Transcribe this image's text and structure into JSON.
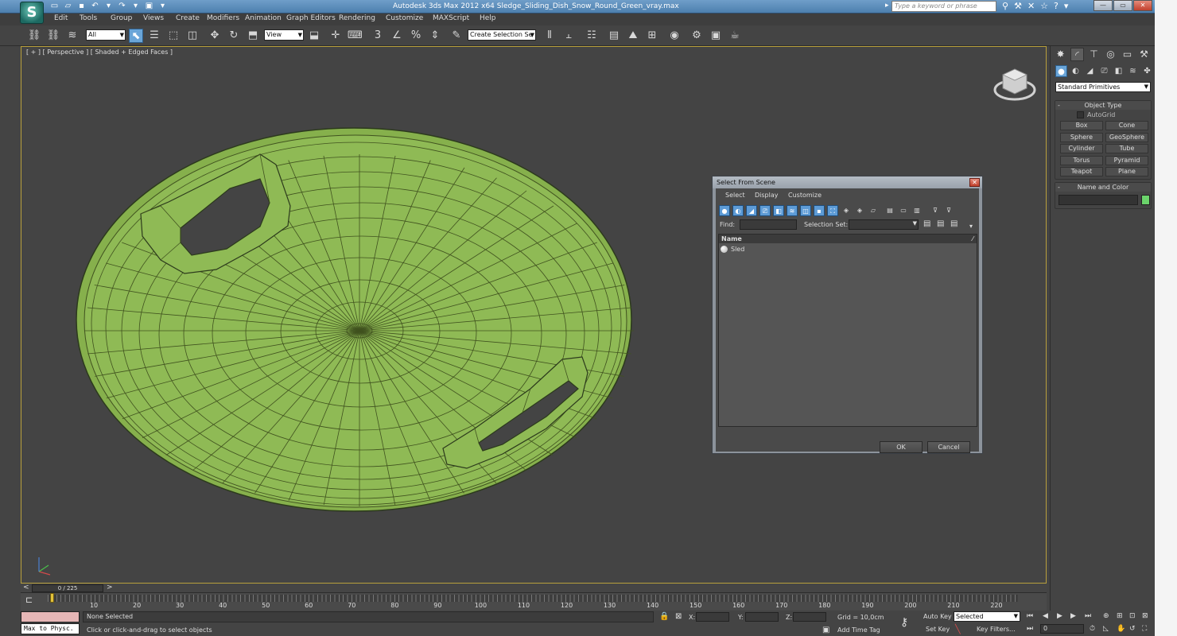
{
  "window": {
    "title": "Autodesk 3ds Max  2012 x64      Sledge_Sliding_Dish_Snow_Round_Green_vray.max",
    "search_placeholder": "Type a keyword or phrase",
    "logo_glyph": "S"
  },
  "menu": [
    "Edit",
    "Tools",
    "Group",
    "Views",
    "Create",
    "Modifiers",
    "Animation",
    "Graph Editors",
    "Rendering",
    "Customize",
    "MAXScript",
    "Help"
  ],
  "toolbar": {
    "filter_value": "All",
    "ref_coord_value": "View",
    "selection_set_value": "Create Selection Se"
  },
  "viewport": {
    "label": "[ + ] [ Perspective ] [ Shaded + Edged Faces ]",
    "object_color": "#8cb552"
  },
  "command_panel": {
    "category_value": "Standard Primitives",
    "object_type_title": "Object Type",
    "autogrid_label": "AutoGrid",
    "primitives": [
      "Box",
      "Cone",
      "Sphere",
      "GeoSphere",
      "Cylinder",
      "Tube",
      "Torus",
      "Pyramid",
      "Teapot",
      "Plane"
    ],
    "name_color_title": "Name and Color",
    "swatch_color": "#6bd36b"
  },
  "dialog": {
    "title": "Select From Scene",
    "menu": [
      "Select",
      "Display",
      "Customize"
    ],
    "find_label": "Find:",
    "selection_set_label": "Selection Set:",
    "list_header": "Name",
    "items": [
      "Sled"
    ],
    "ok_label": "OK",
    "cancel_label": "Cancel"
  },
  "timeline": {
    "slider_label": "0 / 225",
    "ticks": [
      10,
      20,
      30,
      40,
      50,
      60,
      70,
      80,
      90,
      100,
      110,
      120,
      130,
      140,
      150,
      160,
      170,
      180,
      190,
      200,
      210,
      220
    ]
  },
  "status": {
    "script_text": "Max to Physc.",
    "selection_status": "None Selected",
    "prompt": "Click or click-and-drag to select objects",
    "x_label": "X:",
    "y_label": "Y:",
    "z_label": "Z:",
    "grid": "Grid = 10,0cm",
    "add_time_tag": "Add Time Tag",
    "auto_key": "Auto Key",
    "set_key": "Set Key",
    "key_mode_value": "Selected",
    "key_filters": "Key Filters...",
    "frame_value": "0"
  }
}
